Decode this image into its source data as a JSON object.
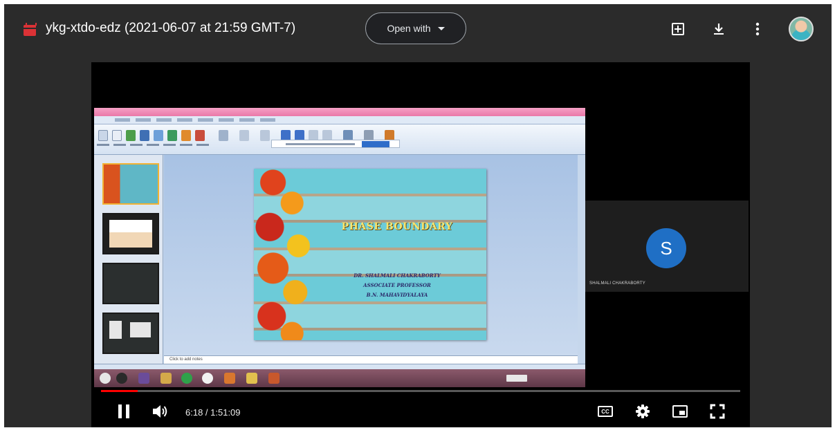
{
  "viewer": {
    "file_title": "ykg-xtdo-edz (2021-06-07 at 21:59 GMT-7)",
    "open_with_label": "Open with",
    "icons": {
      "file": "video-file-icon",
      "add_comment": "add-comment-icon",
      "download": "download-icon",
      "more": "more-vert-icon",
      "account": "user-avatar"
    }
  },
  "colors": {
    "file_icon": "#db3236",
    "progress": "#ff0000",
    "participant_avatar": "#1f6fc5"
  },
  "meeting": {
    "participant_initial": "S",
    "participant_name": "SHALMALI CHAKRABORTY"
  },
  "slide": {
    "title": "PHASE BOUNDARY",
    "lines": [
      "DR. SHALMALI CHAKRABORTY",
      "ASSOCIATE PROFESSOR",
      "B.N. MAHAVIDYALAYA"
    ],
    "notes_placeholder": "Click to add notes"
  },
  "player": {
    "time_display": "6:18 / 1:51:09",
    "progress_fraction": 0.057,
    "cc_label": "CC",
    "icons": [
      "pause-icon",
      "volume-icon",
      "captions-icon",
      "settings-icon",
      "miniplayer-icon",
      "fullscreen-icon"
    ]
  }
}
